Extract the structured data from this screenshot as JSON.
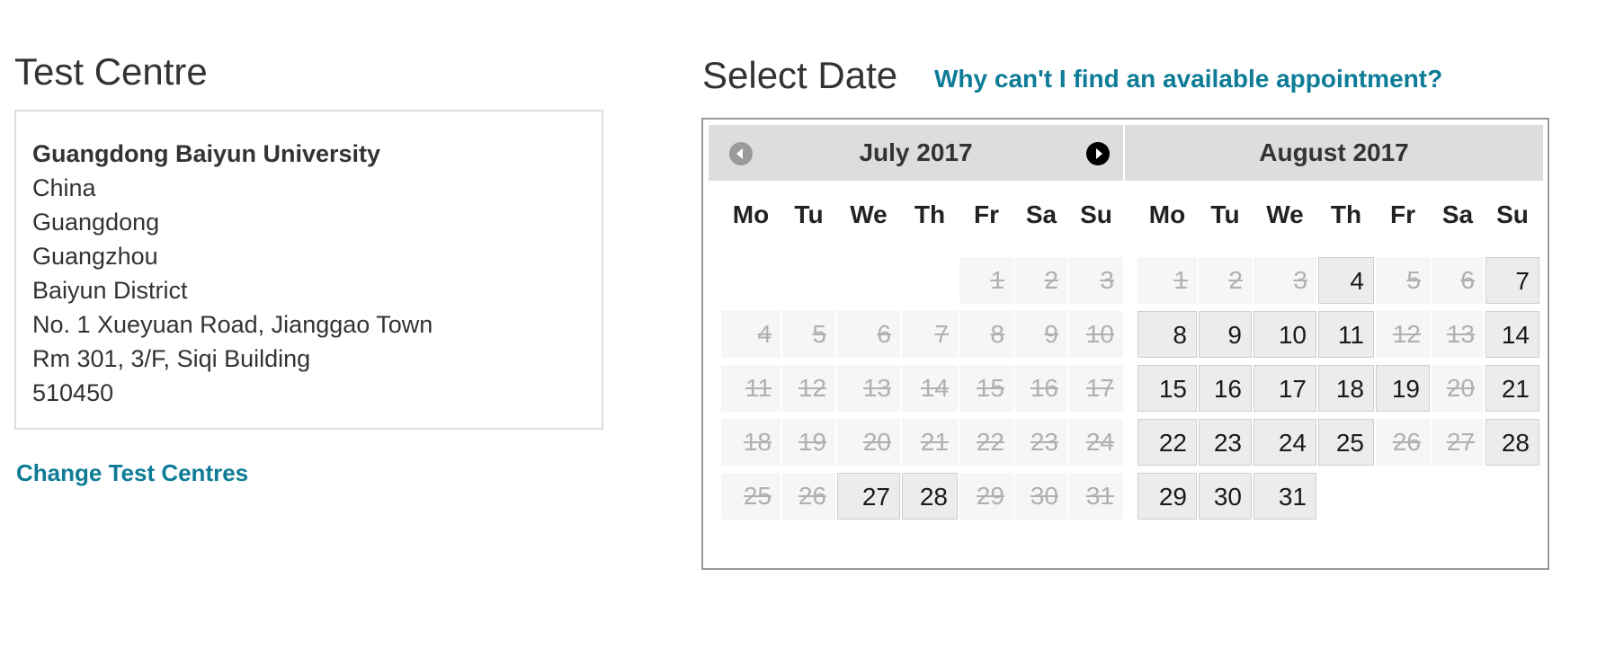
{
  "test_centre": {
    "heading": "Test Centre",
    "address_lines": [
      "Guangdong Baiyun University",
      "China",
      "Guangdong",
      "Guangzhou",
      "Baiyun District",
      "No. 1 Xueyuan Road, Jianggao Town",
      "Rm 301, 3/F, Siqi Building",
      "510450"
    ],
    "change_link": "Change Test Centres"
  },
  "select_date": {
    "heading": "Select Date",
    "help_link": "Why can't I find an available appointment?"
  },
  "calendar": {
    "weekdays": [
      "Mo",
      "Tu",
      "We",
      "Th",
      "Fr",
      "Sa",
      "Su"
    ],
    "prev_icon": "circle-arrow-left-icon",
    "next_icon": "circle-arrow-right-icon",
    "months": [
      {
        "title": "July 2017",
        "first_weekday": 5,
        "days": 31,
        "available": [
          27,
          28
        ]
      },
      {
        "title": "August 2017",
        "first_weekday": 1,
        "days": 31,
        "available": [
          4,
          7,
          8,
          9,
          10,
          11,
          14,
          15,
          16,
          17,
          18,
          19,
          21,
          22,
          23,
          24,
          25,
          28,
          29,
          30,
          31
        ]
      }
    ]
  },
  "colors": {
    "link": "#0e7c97",
    "available_bg": "#ececec",
    "unavailable_bg": "#f6f6f6",
    "header_bg": "#dddddd"
  }
}
